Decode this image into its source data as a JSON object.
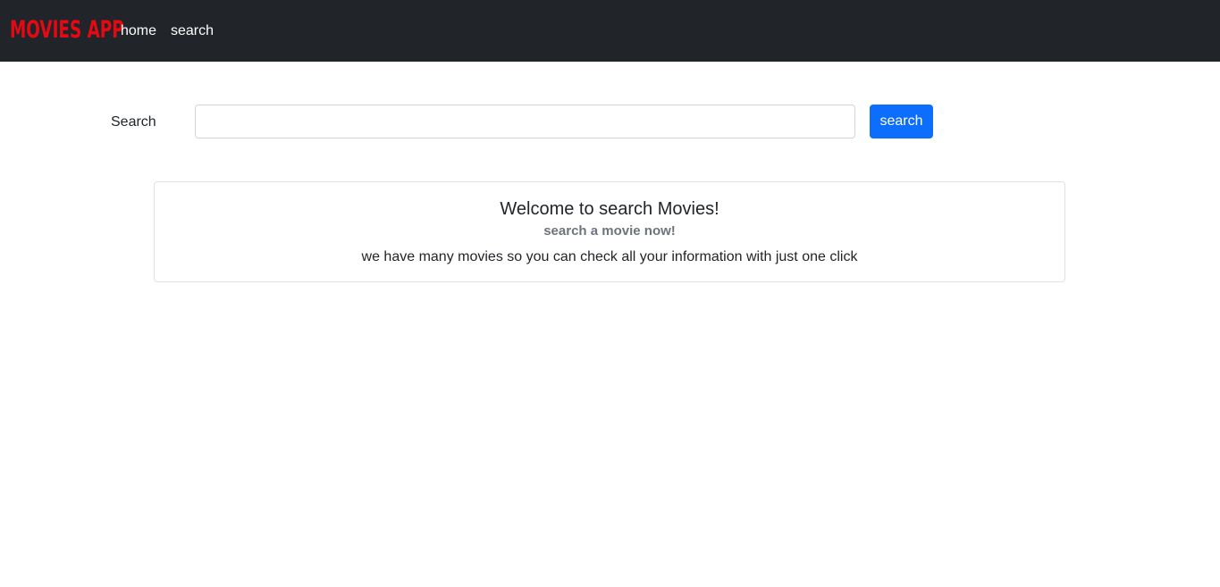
{
  "navbar": {
    "brand": "MOVIES APP",
    "links": [
      {
        "label": "home"
      },
      {
        "label": "search"
      }
    ]
  },
  "search": {
    "label": "Search",
    "value": "",
    "placeholder": "",
    "button_label": "search"
  },
  "card": {
    "title": "Welcome to search Movies!",
    "subtitle": "search a movie now!",
    "text": "we have many movies so you can check all your information with just one click"
  },
  "colors": {
    "navbar_bg": "#212529",
    "brand": "#e50914",
    "primary_button": "#0d6efd",
    "subtitle": "#6c757d"
  }
}
